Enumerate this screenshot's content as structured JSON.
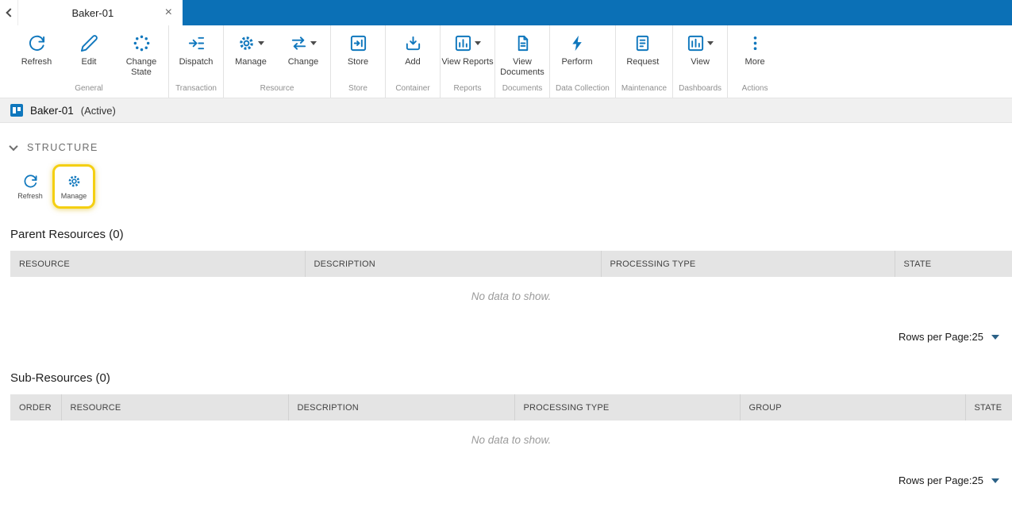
{
  "colors": {
    "topbar_blue": "#0b70b6",
    "icon_blue": "#0f77bd",
    "highlight_yellow": "#f4cf12",
    "header_gray": "#e4e4e4"
  },
  "topbar": {
    "tab_title": "Baker-01",
    "close_icon": "×"
  },
  "ribbon": {
    "groups": [
      {
        "label": "General",
        "buttons": [
          {
            "label": "Refresh"
          },
          {
            "label": "Edit"
          },
          {
            "label": "Change State"
          }
        ]
      },
      {
        "label": "Transaction",
        "buttons": [
          {
            "label": "Dispatch"
          }
        ]
      },
      {
        "label": "Resource",
        "buttons": [
          {
            "label": "Manage"
          },
          {
            "label": "Change"
          }
        ]
      },
      {
        "label": "Store",
        "buttons": [
          {
            "label": "Store"
          }
        ]
      },
      {
        "label": "Container",
        "buttons": [
          {
            "label": "Add"
          }
        ]
      },
      {
        "label": "Reports",
        "buttons": [
          {
            "label": "View Reports"
          }
        ]
      },
      {
        "label": "Documents",
        "buttons": [
          {
            "label": "View Documents"
          }
        ]
      },
      {
        "label": "Data Collection",
        "buttons": [
          {
            "label": "Perform"
          }
        ]
      },
      {
        "label": "Maintenance",
        "buttons": [
          {
            "label": "Request"
          }
        ]
      },
      {
        "label": "Dashboards",
        "buttons": [
          {
            "label": "View"
          }
        ]
      },
      {
        "label": "Actions",
        "buttons": [
          {
            "label": "More"
          }
        ]
      }
    ]
  },
  "entity": {
    "name": "Baker-01",
    "state": "(Active)"
  },
  "structure": {
    "title": "STRUCTURE",
    "refresh_label": "Refresh",
    "manage_label": "Manage"
  },
  "parent_resources": {
    "title": "Parent Resources (0)",
    "columns": [
      "RESOURCE",
      "DESCRIPTION",
      "PROCESSING TYPE",
      "STATE"
    ],
    "empty_text": "No data to show.",
    "rows_per_page_label": "Rows per Page:",
    "rows_per_page_value": "25"
  },
  "sub_resources": {
    "title": "Sub-Resources (0)",
    "columns": [
      "ORDER",
      "RESOURCE",
      "DESCRIPTION",
      "PROCESSING TYPE",
      "GROUP",
      "STATE"
    ],
    "empty_text": "No data to show.",
    "rows_per_page_label": "Rows per Page:",
    "rows_per_page_value": "25"
  }
}
